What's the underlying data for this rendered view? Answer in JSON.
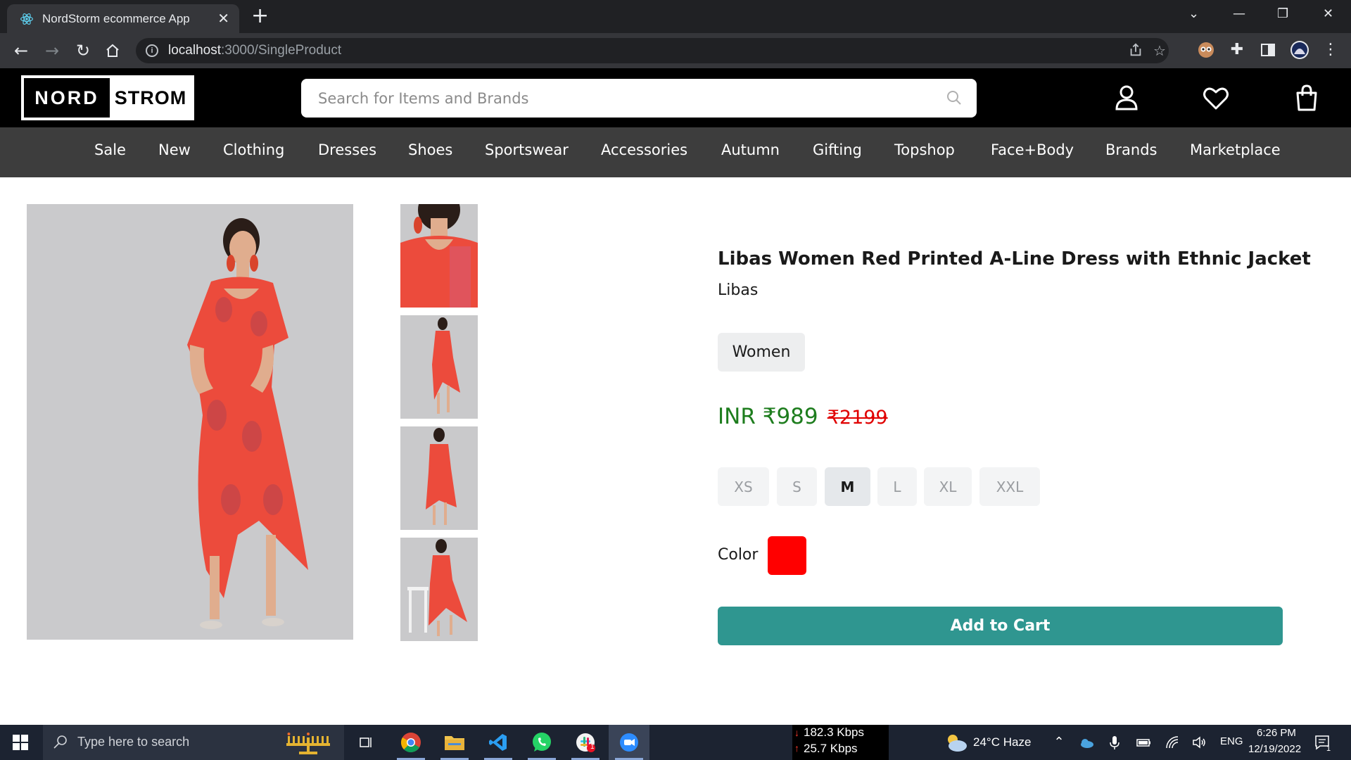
{
  "browser": {
    "tab_title": "NordStorm ecommerce App",
    "url_host": "localhost",
    "url_path": ":3000/SingleProduct"
  },
  "site": {
    "logo_left": "NORD",
    "logo_right": "STROM",
    "search_placeholder": "Search for Items and Brands"
  },
  "nav": {
    "items": [
      "Sale",
      "New",
      "Clothing",
      "Dresses",
      "Shoes",
      "Sportswear",
      "Accessories",
      "Autumn",
      "Gifting",
      "Topshop",
      "Face+Body",
      "Brands",
      "Marketplace"
    ]
  },
  "product": {
    "title": "Libas Women Red Printed A-Line Dress with Ethnic Jacket",
    "brand": "Libas",
    "category": "Women",
    "price_current": "INR ₹989",
    "price_original": "₹2199",
    "sizes": [
      "XS",
      "S",
      "M",
      "L",
      "XL",
      "XXL"
    ],
    "selected_size": "M",
    "color_label": "Color",
    "color_value": "#ff0000",
    "add_to_cart_label": "Add to Cart",
    "button_color": "#2f9690"
  },
  "taskbar": {
    "search_text": "Type here to search",
    "net_down": "182.3 Kbps",
    "net_up": "25.7 Kbps",
    "weather": "24°C  Haze",
    "language": "ENG",
    "time": "6:26 PM",
    "date": "12/19/2022",
    "notification_count": "1"
  }
}
